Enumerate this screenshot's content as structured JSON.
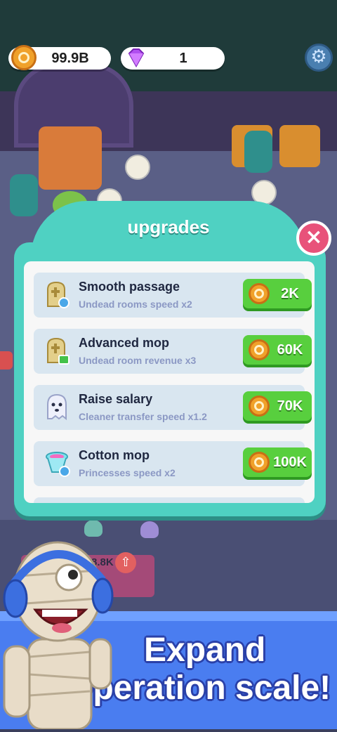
{
  "currency": {
    "coins": "99.9B",
    "gems": "1"
  },
  "upgrades": {
    "title": "upgrades",
    "close_label": "×",
    "items": [
      {
        "name": "Smooth passage",
        "description": "Undead rooms speed x2",
        "price": "2K",
        "icon": "tombstone-clock-icon"
      },
      {
        "name": "Advanced mop",
        "description": "Undead room revenue x3",
        "price": "60K",
        "icon": "tombstone-money-icon"
      },
      {
        "name": "Raise salary",
        "description": "Cleaner transfer speed x1.2",
        "price": "70K",
        "icon": "ghost-icon"
      },
      {
        "name": "Cotton mop",
        "description": "Princesses speed x2",
        "price": "100K",
        "icon": "bucket-clock-icon"
      }
    ]
  },
  "scene": {
    "bubble_value": "8.8K"
  },
  "promo": {
    "line1": "Expand",
    "line2": "Operation scale!"
  },
  "colors": {
    "panel": "#4fd1c2",
    "buy_button": "#58cf3e",
    "close_button": "#e8527a",
    "banner": "#4a7df0"
  }
}
